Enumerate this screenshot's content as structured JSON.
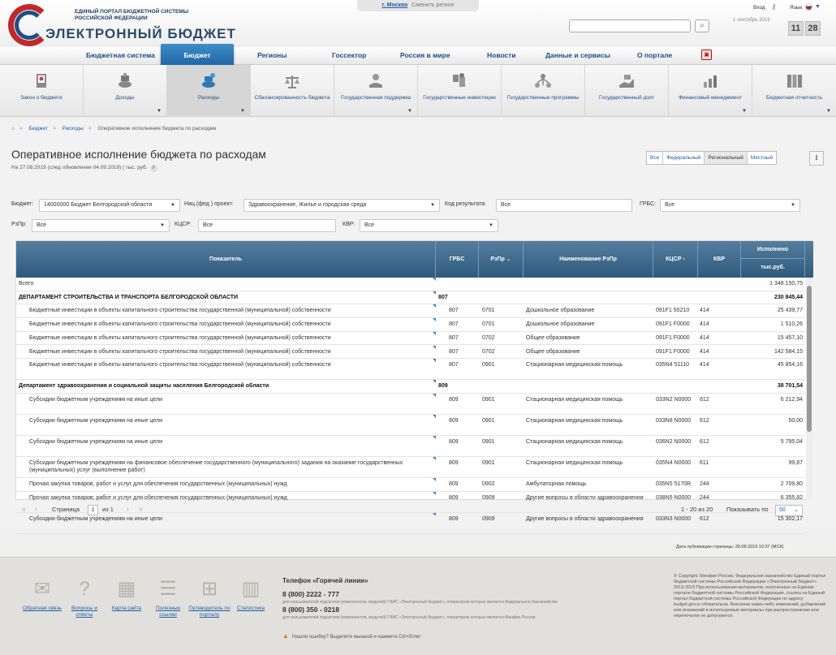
{
  "header": {
    "portal_subtitle": "ЕДИНЫЙ ПОРТАЛ БЮДЖЕТНОЙ СИСТЕМЫ РОССИЙСКОЙ ФЕДЕРАЦИИ",
    "portal_title": "ЭЛЕКТРОННЫЙ БЮДЖЕТ",
    "region_city": "г. Москва",
    "region_change": "Сменить регион",
    "login": "Вход",
    "language": "Язык",
    "date": "1 сентябрь 2019",
    "hours": "11",
    "minutes": "28",
    "search_placeholder": ""
  },
  "main_nav": [
    {
      "label": "Бюджетная система"
    },
    {
      "label": "Бюджет"
    },
    {
      "label": "Регионы"
    },
    {
      "label": "Госсектор"
    },
    {
      "label": "Россия в мире"
    },
    {
      "label": "Новости"
    },
    {
      "label": "Данные и сервисы"
    },
    {
      "label": "О портале"
    }
  ],
  "sub_nav": [
    {
      "label": "Закон о бюджете",
      "icon": "law-icon"
    },
    {
      "label": "Доходы",
      "icon": "income-icon"
    },
    {
      "label": "Расходы",
      "icon": "expenses-icon"
    },
    {
      "label": "Сбалансированность бюджета",
      "icon": "balance-icon"
    },
    {
      "label": "Государственная поддержка",
      "icon": "support-icon"
    },
    {
      "label": "Государственные инвестиции",
      "icon": "investment-icon"
    },
    {
      "label": "Государственные программы",
      "icon": "programs-icon"
    },
    {
      "label": "Государственный долг",
      "icon": "debt-icon"
    },
    {
      "label": "Финансовый менеджмент",
      "icon": "finance-management-icon"
    },
    {
      "label": "Бюджетная отчетность",
      "icon": "reporting-icon"
    }
  ],
  "breadcrumb": [
    "Бюджет",
    "Расходы",
    "Оперативное исполнение бюджета по расходам"
  ],
  "page": {
    "title": "Оперативное исполнение бюджета по расходам",
    "subtitle": "На 27.08.2019 (след обновление 04.09.2019) | тыс. руб."
  },
  "level_tabs": [
    "Все",
    "Федеральный",
    "Региональный",
    "Местный"
  ],
  "filters": {
    "budget_label": "Бюджет:",
    "budget_value": "14000000 Бюджет Белгородской области",
    "project_label": "Нац (фед ) проект:",
    "project_value": "Здравоохранение, Жилье и городская среда",
    "result_label": "Код результата:",
    "result_value": "Все",
    "grbs_label": "ГРБС:",
    "grbs_value": "Все",
    "rzpr_label": "РзПр:",
    "rzpr_value": "Все",
    "kcsr_label": "КЦСР:",
    "kcsr_value": "Все",
    "kvr_label": "КВР:",
    "kvr_value": "Все"
  },
  "table": {
    "headers": {
      "indicator": "Показатель",
      "grbs": "ГРБС",
      "rzpr": "РзПр",
      "rzpr_name": "Наименование РзПр",
      "kcsr": "КЦСР",
      "kvr": "КВР",
      "executed": "Исполнено",
      "executed_unit": "тыс.руб."
    },
    "rows": [
      {
        "name": "Всего",
        "grbs": "",
        "rzpr": "",
        "rzpr_name": "",
        "kcsr": "",
        "kvr": "",
        "value": "1 348 150,75",
        "bold": false,
        "indent": false
      },
      {
        "name": "ДЕПАРТАМЕНТ СТРОИТЕЛЬСТВА И ТРАНСПОРТА БЕЛГОРОДСКОЙ ОБЛАСТИ",
        "grbs": "807",
        "rzpr": "",
        "rzpr_name": "",
        "kcsr": "",
        "kvr": "",
        "value": "230 845,44",
        "bold": true,
        "indent": false
      },
      {
        "name": "Бюджетные инвестиции в объекты капитального строительства государственной (муниципальной) собственности",
        "grbs": "807",
        "rzpr": "0701",
        "rzpr_name": "Дошкольное образование",
        "kcsr": "091F1 50210",
        "kvr": "414",
        "value": "25 439,77",
        "bold": false,
        "indent": true
      },
      {
        "name": "Бюджетные инвестиции в объекты капитального строительства государственной (муниципальной) собственности",
        "grbs": "807",
        "rzpr": "0701",
        "rzpr_name": "Дошкольное образование",
        "kcsr": "091F1 F0000",
        "kvr": "414",
        "value": "1 510,26",
        "bold": false,
        "indent": true
      },
      {
        "name": "Бюджетные инвестиции в объекты капитального строительства государственной (муниципальной) собственности",
        "grbs": "807",
        "rzpr": "0702",
        "rzpr_name": "Общее образование",
        "kcsr": "091F1 F0000",
        "kvr": "414",
        "value": "15 457,10",
        "bold": false,
        "indent": true
      },
      {
        "name": "Бюджетные инвестиции в объекты капитального строительства государственной (муниципальной) собственности",
        "grbs": "807",
        "rzpr": "0702",
        "rzpr_name": "Общее образование",
        "kcsr": "091F1 F0000",
        "kvr": "414",
        "value": "142 584,15",
        "bold": false,
        "indent": true
      },
      {
        "name": "Бюджетные инвестиции в объекты капитального строительства государственной (муниципальной) собственности",
        "grbs": "807",
        "rzpr": "0901",
        "rzpr_name": "Стационарная медицинская помощь",
        "kcsr": "035N4 51110",
        "kvr": "414",
        "value": "45 854,16",
        "bold": false,
        "indent": true
      },
      {
        "name": "Департамент здравоохранения и социальной защиты населения Белгородской области",
        "grbs": "809",
        "rzpr": "",
        "rzpr_name": "",
        "kcsr": "",
        "kvr": "",
        "value": "38 701,54",
        "bold": true,
        "indent": false
      },
      {
        "name": "Субсидии бюджетным учреждениям на иные цели",
        "grbs": "809",
        "rzpr": "0901",
        "rzpr_name": "Стационарная медицинская помощь",
        "kcsr": "033N2 N0000",
        "kvr": "612",
        "value": "6 212,94",
        "bold": false,
        "indent": true
      },
      {
        "name": "Субсидии бюджетным учреждениям на иные цели",
        "grbs": "809",
        "rzpr": "0901",
        "rzpr_name": "Стационарная медицинская помощь",
        "kcsr": "033N8 N0000",
        "kvr": "612",
        "value": "50,00",
        "bold": false,
        "indent": true
      },
      {
        "name": "Субсидии бюджетным учреждениям на иные цели",
        "grbs": "809",
        "rzpr": "0901",
        "rzpr_name": "Стационарная медицинская помощь",
        "kcsr": "036N2 N0000",
        "kvr": "612",
        "value": "5 795,04",
        "bold": false,
        "indent": true
      },
      {
        "name": "Субсидии бюджетным учреждениям на финансовое обеспечение государственного (муниципального) задания на оказание государственных (муниципальных) услуг (выполнение работ)",
        "grbs": "809",
        "rzpr": "0901",
        "rzpr_name": "Стационарная медицинская помощь",
        "kcsr": "035N4 N0000",
        "kvr": "611",
        "value": "99,87",
        "bold": false,
        "indent": true
      },
      {
        "name": "Прочая закупка товаров, работ и услуг для обеспечения государственных (муниципальных) нужд",
        "grbs": "809",
        "rzpr": "0902",
        "rzpr_name": "Амбулаторная помощь",
        "kcsr": "035N5 5170R",
        "kvr": "244",
        "value": "2 709,80",
        "bold": false,
        "indent": true
      },
      {
        "name": "Прочая закупка товаров, работ и услуг для обеспечения государственных (муниципальных) нужд",
        "grbs": "809",
        "rzpr": "0909",
        "rzpr_name": "Другие вопросы в области здравоохранения",
        "kcsr": "038N5 N0000",
        "kvr": "244",
        "value": "6 355,82",
        "bold": false,
        "indent": true
      },
      {
        "name": "Субсидии бюджетным учреждениям на иные цели",
        "grbs": "809",
        "rzpr": "0909",
        "rzpr_name": "Другие вопросы в области здравоохранения",
        "kcsr": "033N3 N0000",
        "kvr": "612",
        "value": "15 302,17",
        "bold": false,
        "indent": true
      }
    ]
  },
  "pager": {
    "page_label": "Страница",
    "page_value": "1",
    "of_label": "из 1",
    "range": "1 - 20 из 20",
    "page_size_label": "Показывать по",
    "page_size": "50"
  },
  "publication_date": "Дата публикации страницы: 28.08.2019 10:37 (МСК)",
  "footer": {
    "links": [
      {
        "label": "Обратная связь",
        "icon": "envelope-icon"
      },
      {
        "label": "Вопросы и ответы",
        "icon": "question-icon"
      },
      {
        "label": "Карта сайта",
        "icon": "map-icon"
      },
      {
        "label": "Полезные ссылки",
        "icon": "links-icon"
      },
      {
        "label": "Путеводитель по порталу",
        "icon": "guide-icon"
      },
      {
        "label": "Статистика",
        "icon": "statistics-icon"
      }
    ],
    "hotline_title": "Телефон «Горячей линии»",
    "phone1": "8 (800) 2222 - 777",
    "phone1_note": "для пользователей подсистем (компонентов, модулей) ГИИС «Электронный бюджет», оператором которых является Федеральное Казначейство",
    "phone2": "8 (800) 350 - 0218",
    "phone2_note": "для пользователей подсистем (компонентов, модулей) ГИИС «Электронный бюджет», оператором которых является Минфин России",
    "error_note": "Нашли ошибку? Выделите мышкой и нажмите Ctrl+Enter",
    "copyright": "© Copyright. Минфин России, Федеральное казначейство Единый портал бюджетной системы Российской Федерации «Электронный бюджет» 2013-2019 При использовании материалов, полученных на Едином портале бюджетной системы Российской Федерации, ссылка на Единый портал бюджетной системы Российской Федерации по адресу budget.gov.ru обязательна. Внесение каких-либо изменений, добавлений или искажений в используемые материалы при распространении или перепечатке не допускается."
  },
  "colors": {
    "brand_blue": "#1d4f86",
    "active_tab": "#2f78b8",
    "table_header": "#3f6a8c",
    "brand_red": "#c0282d"
  }
}
